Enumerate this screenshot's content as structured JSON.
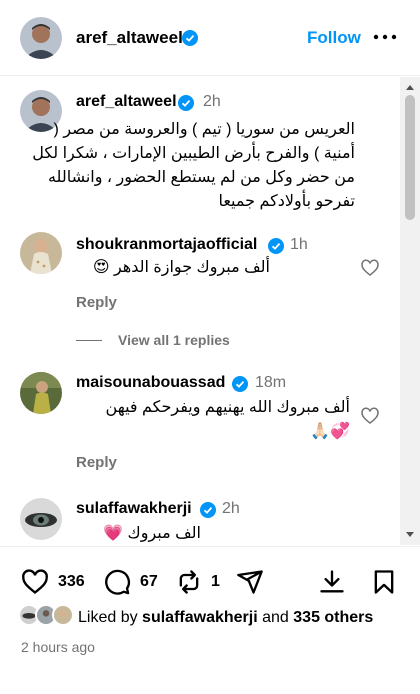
{
  "post": {
    "author": "aref_altaweel",
    "follow_label": "Follow"
  },
  "caption": {
    "user": "aref_altaweel",
    "time": "2h",
    "text": "العريس من سوريا ( تيم ) والعروسة من مصر ( أمنية ) والفرح بأرض الطيبين الإمارات ، شكرا لكل من حضر وكل من لم يستطع الحضور ، وانشالله تفرحو بأولادكم جميعا"
  },
  "comments": [
    {
      "user": "shoukranmortajaofficial",
      "time": "1h",
      "text": "ألف مبروك جوازة الدهر 😍",
      "reply": "Reply",
      "view_replies": "View all 1 replies"
    },
    {
      "user": "maisounabouassad",
      "time": "18m",
      "text": "ألف مبروك الله يهنيهم ويفرحكم فيهن 💞🙏🏻",
      "reply": "Reply"
    },
    {
      "user": "sulaffawakherji",
      "time": "2h",
      "text": "الف مبروك 💗"
    }
  ],
  "actions": {
    "likes": "336",
    "comments": "67",
    "reposts": "1"
  },
  "liked_by": {
    "prefix": "Liked by",
    "user": "sulaffawakherji",
    "and": "and",
    "others": "335 others"
  },
  "time_ago": "2 hours ago",
  "colors": {
    "accent": "#0095f6",
    "muted": "#737373",
    "like_red": "#ed4956"
  }
}
